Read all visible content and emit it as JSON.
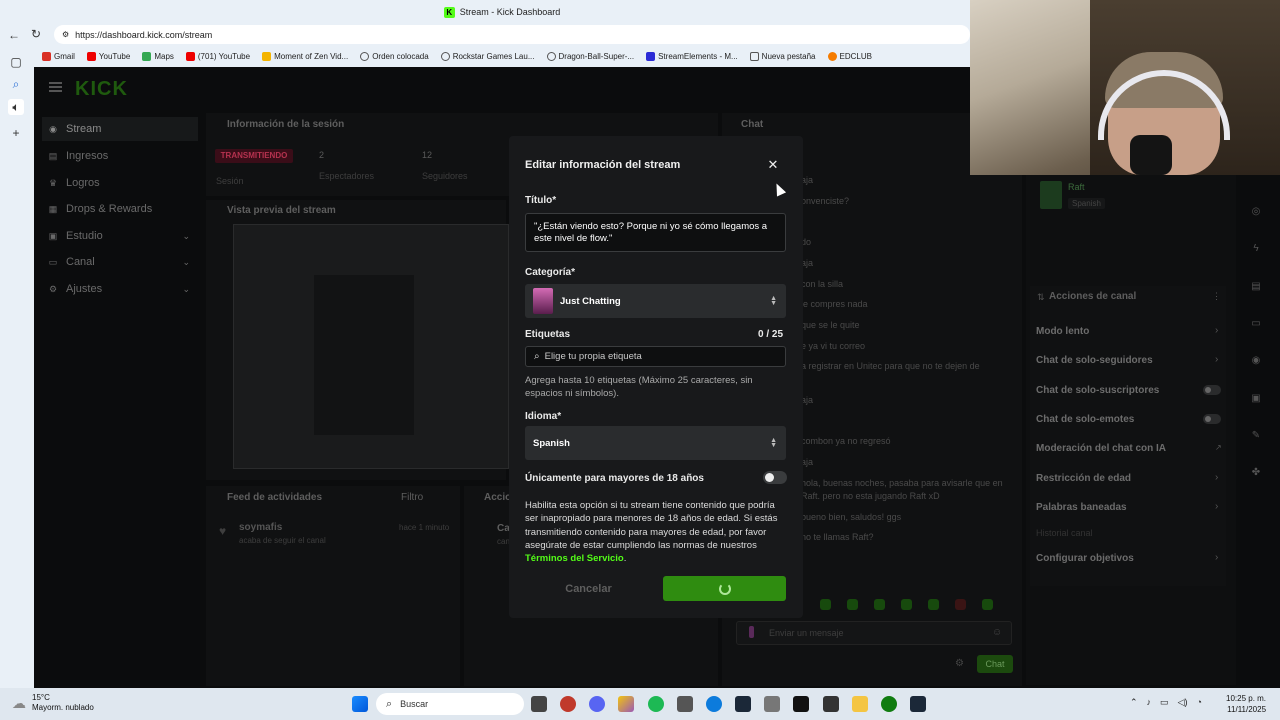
{
  "browser": {
    "window_title": "Stream - Kick Dashboard",
    "url": "https://dashboard.kick.com/stream",
    "bookmarks": [
      "Gmail",
      "YouTube",
      "Maps",
      "(701) YouTube",
      "Moment of Zen Vid...",
      "Orden colocada",
      "Rockstar Games Lau...",
      "Dragon-Ball-Super-...",
      "StreamElements - M...",
      "Nueva pestaña",
      "EDCLUB"
    ]
  },
  "sidebar": {
    "logo": "KICK",
    "items": [
      {
        "label": "Stream",
        "icon": "stream-icon"
      },
      {
        "label": "Ingresos",
        "icon": "money-icon"
      },
      {
        "label": "Logros",
        "icon": "trophy-icon"
      },
      {
        "label": "Drops & Rewards",
        "icon": "gift-icon"
      },
      {
        "label": "Estudio",
        "icon": "studio-icon"
      },
      {
        "label": "Canal",
        "icon": "channel-icon"
      },
      {
        "label": "Ajustes",
        "icon": "gear-icon"
      }
    ]
  },
  "session": {
    "header": "Información de la sesión",
    "live_badge": "TRANSMITIENDO",
    "session_label": "Sesión",
    "viewers_value": "2",
    "viewers_label": "Espectadores",
    "followers_value": "12",
    "followers_label": "Seguidores"
  },
  "preview": {
    "header": "Vista previa del stream"
  },
  "activity": {
    "header": "Feed de actividades",
    "filter": "Filtro",
    "user": "soymafis",
    "event": "acaba de seguir el canal",
    "time": "hace 1 minuto",
    "actions_header": "Acciones",
    "cat_label": "Cat",
    "cat_sub": "can"
  },
  "chat": {
    "header": "Chat",
    "user": "Raft",
    "lang": "Spanish",
    "lines": [
      "aja",
      "onvenciste?",
      "do",
      "aja",
      "con la silla",
      "le compres nada",
      "que se le quite",
      "e ya vi tu correo",
      "a registrar en Unitec para que no te dejen de",
      "aja",
      "combon ya no regresó",
      "aja",
      "hola, buenas noches, pasaba para avisarle que en",
      "Raft. pero no esta jugando Raft xD",
      "bueno bien, saludos! ggs",
      "no te llamas Raft?"
    ],
    "input_placeholder": "Enviar un mensaje",
    "send_label": "Chat"
  },
  "channel_actions": {
    "header": "Acciones de canal",
    "items": [
      "Modo lento",
      "Chat de solo-seguidores",
      "Chat de solo-suscriptores",
      "Chat de solo-emotes",
      "Moderación del chat con IA",
      "Restricción de edad",
      "Palabras baneadas",
      "Historial canal",
      "Configurar objetivos"
    ]
  },
  "modal": {
    "title": "Editar información del stream",
    "title_label": "Título*",
    "title_value": "\"¿Están viendo esto? Porque ni yo sé cómo llegamos a este nivel de flow.\"",
    "category_label": "Categoría*",
    "category_value": "Just Chatting",
    "tags_label": "Etiquetas",
    "tags_count": "0 / 25",
    "tags_placeholder": "Elige tu propia etiqueta",
    "tags_help": "Agrega hasta 10 etiquetas (Máximo 25 caracteres, sin espacios ni símbolos).",
    "language_label": "Idioma*",
    "language_value": "Spanish",
    "adult_label": "Únicamente para mayores de 18 años",
    "adult_enabled": false,
    "adult_help": "Habilita esta opción si tu stream tiene contenido que podría ser inapropiado para menores de 18 años de edad. Si estás transmitiendo contenido para mayores de edad, por favor asegúrate de estar cumpliendo las normas de nuestros",
    "tos_link": "Términos del Servicio",
    "tos_suffix": ".",
    "cancel_label": "Cancelar",
    "save_loading": true
  },
  "taskbar": {
    "temperature": "15°C",
    "weather": "Mayorm. nublado",
    "search_placeholder": "Buscar",
    "time": "10:25 p. m.",
    "date": "11/11/2025"
  },
  "colors": {
    "accent": "#53fc18",
    "save_button": "#2f8c10",
    "live_badge": "#c4173f"
  }
}
